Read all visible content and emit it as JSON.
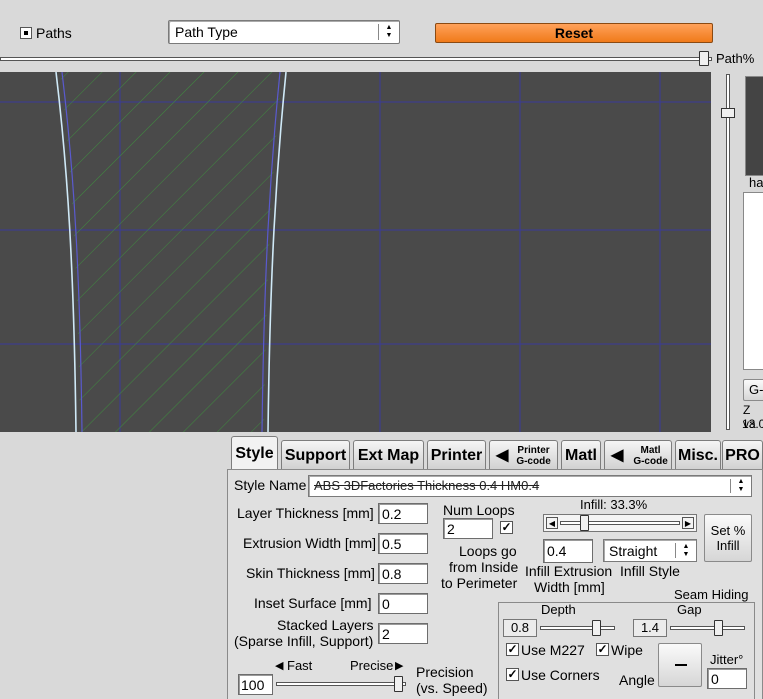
{
  "toolbar": {
    "paths_label": "Paths",
    "path_type": "Path Type",
    "reset_label": "Reset",
    "path_percent_label": "Path%"
  },
  "right_panel": {
    "text_ha": "ha",
    "g_label": "G-",
    "z_label": "Z va",
    "z_value": "13.0"
  },
  "tabs": [
    {
      "label": "Style"
    },
    {
      "label": "Support"
    },
    {
      "label": "Ext Map"
    },
    {
      "label": "Printer"
    },
    {
      "label": "Printer G-code",
      "line1": "Printer",
      "line2": "G-code"
    },
    {
      "label": "Matl"
    },
    {
      "label": "Matl G-code",
      "line1": "Matl",
      "line2": "G-code"
    },
    {
      "label": "Misc."
    },
    {
      "label": "PRO"
    }
  ],
  "style_panel": {
    "style_name_label": "Style Name",
    "style_name_value": "ABS 3DFactories Thickness 0.4 HM0.4",
    "layer_thickness_label": "Layer Thickness [mm]",
    "layer_thickness_value": "0.2",
    "extrusion_width_label": "Extrusion Width [mm]",
    "extrusion_width_value": "0.5",
    "skin_thickness_label": "Skin Thickness [mm]",
    "skin_thickness_value": "0.8",
    "inset_surface_label": "Inset  Surface [mm]",
    "inset_surface_value": "0",
    "stacked_layers_label1": "Stacked Layers",
    "stacked_layers_label2": "(Sparse Infill, Support)",
    "stacked_layers_value": "2",
    "num_loops_label": "Num Loops",
    "num_loops_value": "2",
    "loops_go_1": "Loops go",
    "loops_go_2": "from Inside",
    "loops_go_3": "to Perimeter",
    "infill_label": "Infill: 33.3%",
    "infill_percent": 33.3,
    "set_infill_1": "Set %",
    "set_infill_2": "Infill",
    "infill_extrusion_value": "0.4",
    "infill_extrusion_label1": "Infill Extrusion",
    "infill_extrusion_label2": "Width [mm]",
    "infill_style_value": "Straight",
    "infill_style_label": "Infill Style",
    "fast_label": "Fast",
    "precise_label": "Precise",
    "precision_value": "100",
    "precision_label1": "Precision",
    "precision_label2": "(vs. Speed)",
    "seam_hiding_label": "Seam Hiding",
    "depth_label": "Depth",
    "depth_value": "0.8",
    "gap_label": "Gap",
    "gap_value": "1.4",
    "use_m227_label": "Use M227",
    "wipe_label": "Wipe",
    "use_corners_label": "Use Corners",
    "angle_label": "Angle",
    "jitter_label": "Jitter°",
    "jitter_value": "0"
  }
}
